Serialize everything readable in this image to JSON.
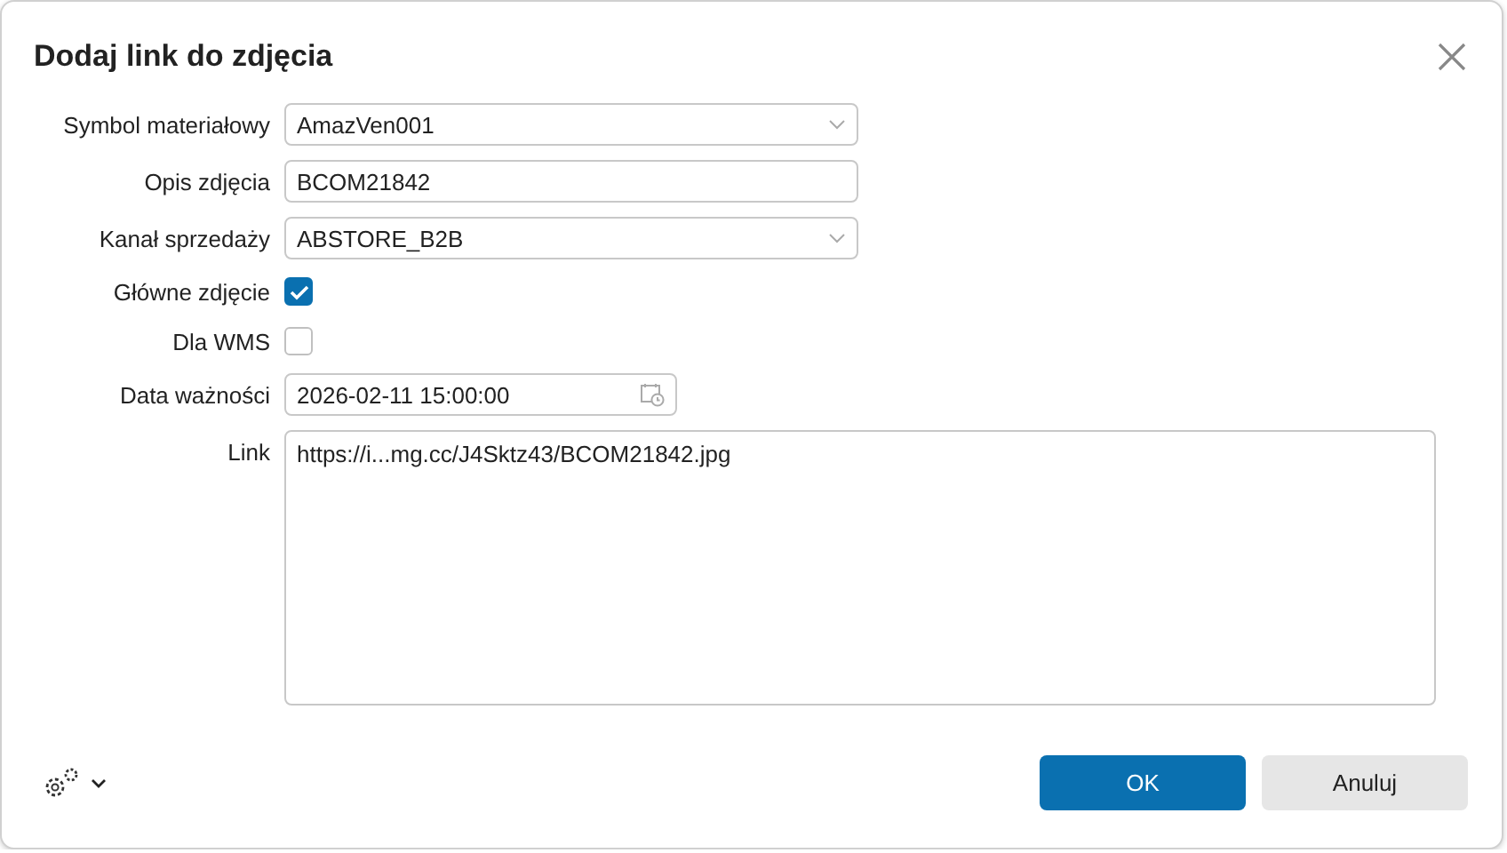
{
  "dialog": {
    "title": "Dodaj link do zdjęcia"
  },
  "fields": [
    {
      "kind": "select",
      "label": "Symbol materiałowy",
      "value": "AmazVen001"
    },
    {
      "kind": "text",
      "label": "Opis zdjęcia",
      "value": "BCOM21842"
    },
    {
      "kind": "select",
      "label": "Kanał sprzedaży",
      "value": "ABSTORE_B2B"
    },
    {
      "kind": "checkbox",
      "label": "Główne zdjęcie",
      "checked": true
    },
    {
      "kind": "checkbox",
      "label": "Dla WMS",
      "checked": false
    },
    {
      "kind": "date",
      "label": "Data ważności",
      "value": "2026-02-11 15:00:00"
    },
    {
      "kind": "textarea",
      "label": "Link",
      "value": "https://i...mg.cc/J4Sktz43/BCOM21842.jpg"
    }
  ],
  "buttons": [
    {
      "label": "OK",
      "primary": true
    },
    {
      "label": "Anuluj",
      "primary": false
    }
  ]
}
